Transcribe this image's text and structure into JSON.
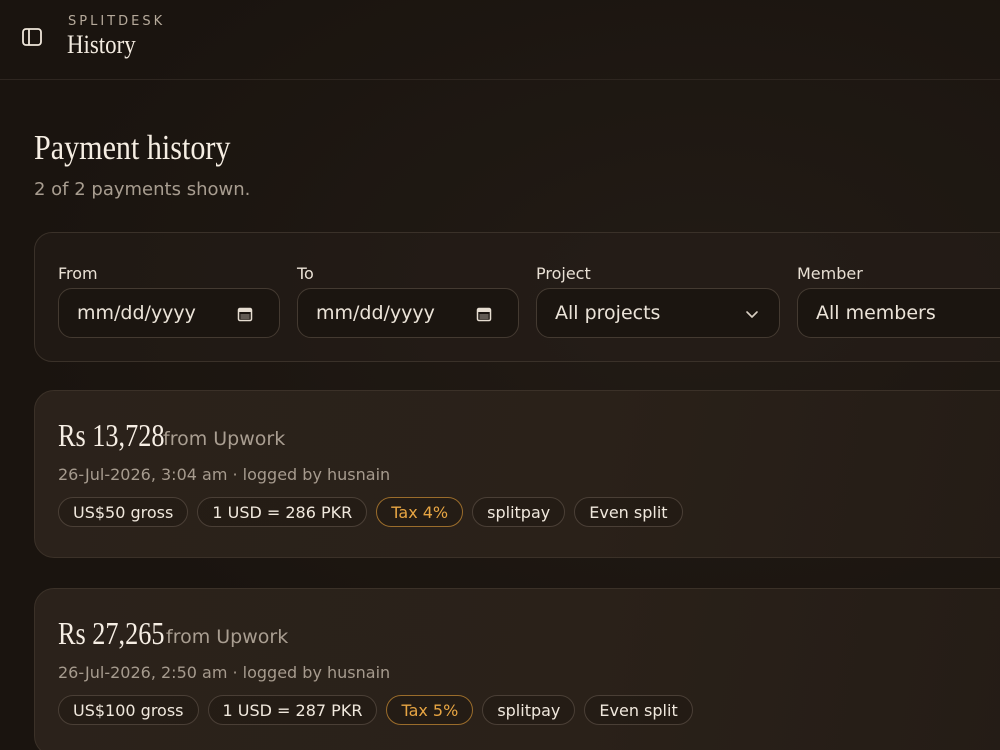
{
  "header": {
    "brand": "SPLITDESK",
    "title": "History"
  },
  "page": {
    "title": "Payment history",
    "subtitle": "2 of 2 payments shown."
  },
  "filters": {
    "from": {
      "label": "From",
      "placeholder": "mm/dd/yyyy"
    },
    "to": {
      "label": "To",
      "placeholder": "mm/dd/yyyy"
    },
    "project": {
      "label": "Project",
      "value": "All projects"
    },
    "member": {
      "label": "Member",
      "value": "All members"
    }
  },
  "payments": [
    {
      "amount": "Rs 13,728",
      "source": "from Upwork",
      "meta": "26-Jul-2026, 3:04 am · logged by husnain",
      "chips": {
        "gross": "US$50 gross",
        "rate": "1 USD = 286 PKR",
        "tax": "Tax 4%",
        "method": "splitpay",
        "split": "Even split"
      }
    },
    {
      "amount": "Rs 27,265",
      "source": "from Upwork",
      "meta": "26-Jul-2026, 2:50 am · logged by husnain",
      "chips": {
        "gross": "US$100 gross",
        "rate": "1 USD = 287 PKR",
        "tax": "Tax 5%",
        "method": "splitpay",
        "split": "Even split"
      }
    }
  ],
  "colors": {
    "background": "#1c1611",
    "card": "#2b221b",
    "tax_accent": "#e7a543",
    "muted_text": "#a99e91"
  },
  "icons": {
    "sidebar_toggle": "sidebar-toggle-icon",
    "date": "calendar-icon",
    "select": "chevron-down-icon"
  }
}
